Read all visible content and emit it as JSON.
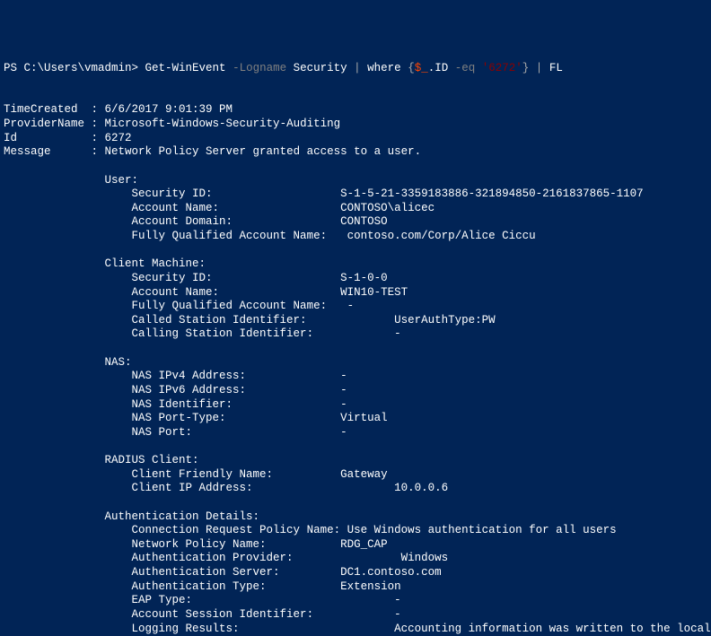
{
  "prompt": {
    "prefix": "PS C:\\Users\\vmadmin> ",
    "cmd": "Get-WinEvent",
    "flag1": "-Logname",
    "arg1": "Security",
    "pipe1": "|",
    "where": "where",
    "lbrace": "{",
    "spvar": "$_",
    "dot_id": ".ID ",
    "eq": "-eq",
    "evid": " '6272'",
    "rbrace": "}",
    "pipe2": "|",
    "fl": "FL"
  },
  "header": {
    "timecreated_label": "TimeCreated",
    "timecreated_value": "6/6/2017 9:01:39 PM",
    "providername_label": "ProviderName",
    "providername_value": "Microsoft-Windows-Security-Auditing",
    "id_label": "Id",
    "id_value": "6272",
    "message_label": "Message",
    "message_value": "Network Policy Server granted access to a user."
  },
  "user": {
    "header": "User:",
    "sid_label": "Security ID:",
    "sid_value": "S-1-5-21-3359183886-321894850-2161837865-1107",
    "acct_label": "Account Name:",
    "acct_value": "CONTOSO\\alicec",
    "domain_label": "Account Domain:",
    "domain_value": "CONTOSO",
    "fqan_label": "Fully Qualified Account Name:",
    "fqan_value": "contoso.com/Corp/Alice Ciccu"
  },
  "client": {
    "header": "Client Machine:",
    "sid_label": "Security ID:",
    "sid_value": "S-1-0-0",
    "acct_label": "Account Name:",
    "acct_value": "WIN10-TEST",
    "fqan_label": "Fully Qualified Account Name:",
    "fqan_value": "-",
    "called_label": "Called Station Identifier:",
    "called_value": "UserAuthType:PW",
    "calling_label": "Calling Station Identifier:",
    "calling_value": "-"
  },
  "nas": {
    "header": "NAS:",
    "ipv4_label": "NAS IPv4 Address:",
    "ipv4_value": "-",
    "ipv6_label": "NAS IPv6 Address:",
    "ipv6_value": "-",
    "id_label": "NAS Identifier:",
    "id_value": "-",
    "porttype_label": "NAS Port-Type:",
    "porttype_value": "Virtual",
    "port_label": "NAS Port:",
    "port_value": "-"
  },
  "radius": {
    "header": "RADIUS Client:",
    "friendly_label": "Client Friendly Name:",
    "friendly_value": "Gateway",
    "ip_label": "Client IP Address:",
    "ip_value": "10.0.0.6"
  },
  "auth": {
    "header": "Authentication Details:",
    "crp_label": "Connection Request Policy Name:",
    "crp_value": "Use Windows authentication for all users",
    "np_label": "Network Policy Name:",
    "np_value": "RDG_CAP",
    "provider_label": "Authentication Provider:",
    "provider_value": "Windows",
    "server_label": "Authentication Server:",
    "server_value": "DC1.contoso.com",
    "type_label": "Authentication Type:",
    "type_value": "Extension",
    "eap_label": "EAP Type:",
    "eap_value": "-",
    "session_label": "Account Session Identifier:",
    "session_value": "-",
    "logging_label": "Logging Results:",
    "logging_value": "Accounting information was written to the local log file."
  }
}
